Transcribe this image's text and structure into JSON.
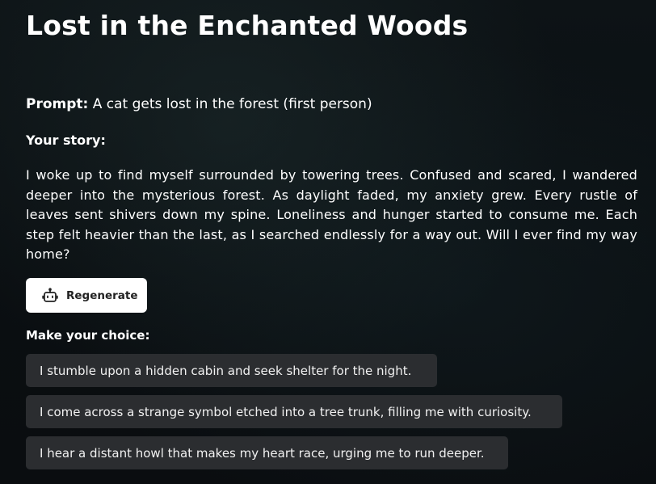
{
  "title": "Lost in the Enchanted Woods",
  "prompt": {
    "label": "Prompt:",
    "text": " A cat gets lost in the forest (first person)"
  },
  "story": {
    "label": "Your story:",
    "text": "I woke up to find myself surrounded by towering trees. Confused and scared, I wandered deeper into the mysterious forest. As daylight faded, my anxiety grew. Every rustle of leaves sent shivers down my spine. Loneliness and hunger started to consume me. Each step felt heavier than the last, as I searched endlessly for a way out. Will I ever find my way home?"
  },
  "regenerate": {
    "label": "Regenerate",
    "icon": "robot-icon"
  },
  "choices": {
    "label": "Make your choice:",
    "items": [
      "I stumble upon a hidden cabin and seek shelter for the night.",
      "I come across a strange symbol etched into a tree trunk, filling me with curiosity.",
      "I hear a distant howl that makes my heart race, urging me to run deeper."
    ]
  }
}
